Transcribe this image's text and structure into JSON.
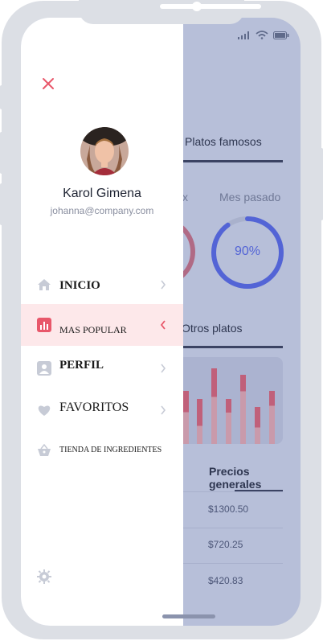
{
  "drawer": {
    "user": {
      "name": "Karol Gimena",
      "email": "johanna@company.com"
    },
    "menu": [
      {
        "label": "INICIO",
        "icon": "home-icon",
        "active": false
      },
      {
        "label": "MAS POPULAR",
        "icon": "bar-chart-icon",
        "active": true
      },
      {
        "label": "PERFIL",
        "icon": "profile-icon",
        "active": false
      },
      {
        "label": "FAVORITOS",
        "icon": "heart-icon",
        "active": false
      },
      {
        "label": "TIENDA DE INGREDIENTES",
        "icon": "basket-icon",
        "active": false
      }
    ],
    "accent": "#e8576a"
  },
  "background": {
    "tabs": {
      "platos_famosos": "Platos famosos",
      "otros_platos": "Otros platos",
      "precios_generales": "Precios generales"
    },
    "stats": {
      "prev_label_partial": "x",
      "mes_pasado": "Mes pasado",
      "mes_pasado_percent": "90%",
      "mes_pasado_value": 90,
      "ring_color": "#5364d6"
    },
    "prices": [
      "$1300.50",
      "$720.25",
      "$420.83"
    ]
  }
}
